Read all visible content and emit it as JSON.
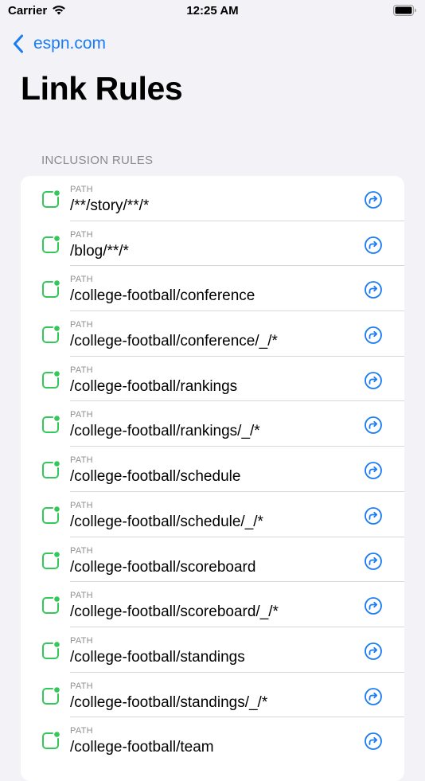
{
  "status_bar": {
    "carrier": "Carrier",
    "time": "12:25 AM"
  },
  "nav": {
    "back_label": "espn.com"
  },
  "page": {
    "title": "Link Rules"
  },
  "section": {
    "header": "INCLUSION RULES"
  },
  "colors": {
    "accent": "#1a7cf5",
    "status_green": "#34c759",
    "background": "#f2f2f7"
  },
  "rules": [
    {
      "kind": "PATH",
      "value": "/**/story/**/*"
    },
    {
      "kind": "PATH",
      "value": "/blog/**/*"
    },
    {
      "kind": "PATH",
      "value": "/college-football/conference"
    },
    {
      "kind": "PATH",
      "value": "/college-football/conference/_/*"
    },
    {
      "kind": "PATH",
      "value": "/college-football/rankings"
    },
    {
      "kind": "PATH",
      "value": "/college-football/rankings/_/*"
    },
    {
      "kind": "PATH",
      "value": "/college-football/schedule"
    },
    {
      "kind": "PATH",
      "value": "/college-football/schedule/_/*"
    },
    {
      "kind": "PATH",
      "value": "/college-football/scoreboard"
    },
    {
      "kind": "PATH",
      "value": "/college-football/scoreboard/_/*"
    },
    {
      "kind": "PATH",
      "value": "/college-football/standings"
    },
    {
      "kind": "PATH",
      "value": "/college-football/standings/_/*"
    },
    {
      "kind": "PATH",
      "value": "/college-football/team"
    }
  ],
  "icons": {
    "rule": "rule-status-icon",
    "action": "open-arrow-icon",
    "back": "chevron-left-icon"
  }
}
